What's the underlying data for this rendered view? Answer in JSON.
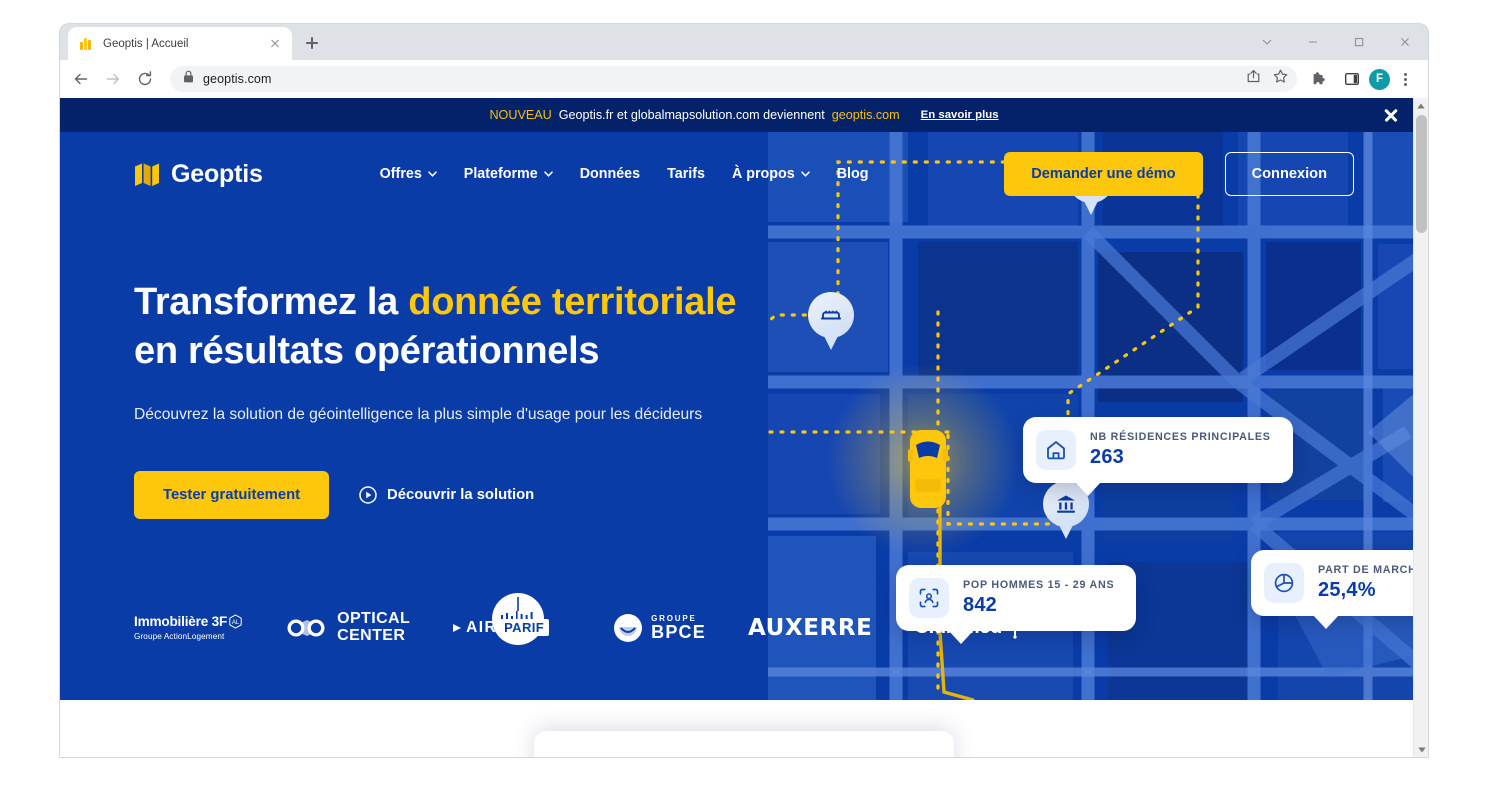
{
  "browser": {
    "tab": {
      "title": "Geoptis | Accueil",
      "favicon_icon": "geoptis-map-favicon",
      "close_icon": "close-icon"
    },
    "new_tab_icon": "plus-icon",
    "window_controls": [
      {
        "name": "chevron-down-icon"
      },
      {
        "name": "minimize-icon"
      },
      {
        "name": "maximize-icon"
      },
      {
        "name": "close-icon"
      }
    ],
    "toolbar": {
      "back_icon": "back-arrow-icon",
      "forward_icon": "forward-arrow-icon",
      "reload_icon": "reload-icon",
      "lock_icon": "lock-icon",
      "url": "geoptis.com",
      "share_icon": "share-icon",
      "bookmark_icon": "star-icon",
      "extensions_icon": "puzzle-piece-icon",
      "sidepanel_icon": "side-panel-icon",
      "avatar_initial": "F",
      "menu_icon": "kebab-menu-icon"
    },
    "scrollbar": {
      "up_icon": "scroll-up-arrow",
      "down_icon": "scroll-down-arrow"
    }
  },
  "announcement": {
    "badge": "NOUVEAU",
    "text": "Geoptis.fr et globalmapsolution.com deviennent",
    "domain": "geoptis.com",
    "link": "En savoir plus",
    "close_icon": "close-icon"
  },
  "nav": {
    "brand": "Geoptis",
    "brand_mark_icon": "geoptis-map-logo",
    "links": [
      {
        "label": "Offres",
        "has_dropdown": true
      },
      {
        "label": "Plateforme",
        "has_dropdown": true
      },
      {
        "label": "Données",
        "has_dropdown": false
      },
      {
        "label": "Tarifs",
        "has_dropdown": false
      },
      {
        "label": "À propos",
        "has_dropdown": true
      },
      {
        "label": "Blog",
        "has_dropdown": false
      }
    ],
    "demo_button": "Demander une démo",
    "login_button": "Connexion"
  },
  "hero": {
    "headline_part1": "Transformez la ",
    "headline_accent": "donnée territoriale",
    "headline_part2": "en résultats opérationnels",
    "subtitle": "Découvrez la solution de géointelligence la plus simple d'usage pour les décideurs",
    "primary_cta": "Tester gratuitement",
    "secondary_cta": "Découvrir la solution",
    "play_icon": "play-circle-icon"
  },
  "map_callouts": [
    {
      "icon": "home-icon",
      "title": "NB RÉSIDENCES PRINCIPALES",
      "value": "263"
    },
    {
      "icon": "people-scan-icon",
      "title": "POP HOMMES 15 - 29 ANS",
      "value": "842"
    },
    {
      "icon": "pie-chart-icon",
      "title": "PART DE MARCHÉ",
      "value": "25,4%"
    }
  ],
  "map_pins": [
    {
      "icon": "shopping-cart-icon"
    },
    {
      "icon": "bed-icon"
    },
    {
      "icon": "bank-icon"
    }
  ],
  "map_vehicle": {
    "icon": "car-icon"
  },
  "client_logos": [
    {
      "name": "immobiliere-3f",
      "line1": "Immobilière 3F",
      "line2": "Groupe ActionLogement"
    },
    {
      "name": "optical-center",
      "line1": "OPTICAL",
      "line2": "CENTER"
    },
    {
      "name": "airparif",
      "line1": "AIR",
      "line2": "PARIF"
    },
    {
      "name": "groupe-bpce",
      "line1": "GROUPE",
      "line2": "BPCE"
    },
    {
      "name": "auxerre",
      "line1": "AUXERRE",
      "line2": ""
    },
    {
      "name": "club-med",
      "line1": "Club Med",
      "line2": ""
    }
  ],
  "colors": {
    "brand_blue": "#0a3ca8",
    "dark_navy": "#042269",
    "accent_yellow": "#fdc70c",
    "white": "#ffffff"
  }
}
